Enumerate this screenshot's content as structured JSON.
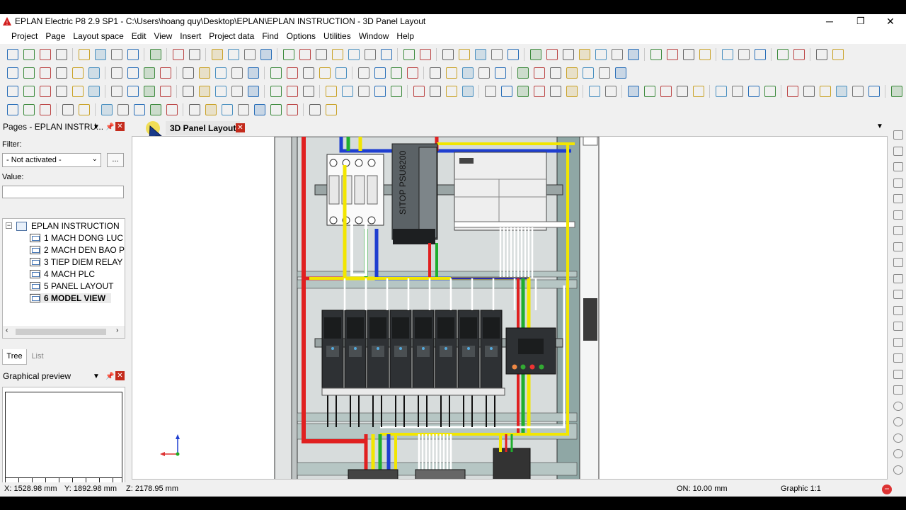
{
  "window": {
    "title": "EPLAN Electric P8 2.9 SP1 - C:\\Users\\hoang quy\\Desktop\\EPLAN\\EPLAN INSTRUCTION - 3D Panel Layout",
    "minimize": "─",
    "restore": "❐",
    "close": "✕"
  },
  "menu": [
    "Project",
    "Page",
    "Layout space",
    "Edit",
    "View",
    "Insert",
    "Project data",
    "Find",
    "Options",
    "Utilities",
    "Window",
    "Help"
  ],
  "pages_panel": {
    "title": "Pages - EPLAN INSTRU...",
    "filter_label": "Filter:",
    "filter_value": "- Not activated -",
    "filter_more": "...",
    "value_label": "Value:",
    "value_text": "",
    "tree_root": "EPLAN INSTRUCTION",
    "pages": [
      {
        "label": "1 MACH DONG LUC",
        "bold": false
      },
      {
        "label": "2 MACH DEN BAO PHA",
        "bold": false
      },
      {
        "label": "3 TIEP DIEM RELAY",
        "bold": false
      },
      {
        "label": "4 MACH PLC",
        "bold": false
      },
      {
        "label": "5 PANEL LAYOUT",
        "bold": false
      },
      {
        "label": "6 MODEL VIEW",
        "bold": true
      }
    ],
    "tab_tree": "Tree",
    "tab_list": "List"
  },
  "preview_panel": {
    "title": "Graphical preview"
  },
  "editor": {
    "tab_label": "3D Panel Layout",
    "psu_label": "SITOP PSU8200",
    "colors": {
      "red": "#e02020",
      "blue": "#1f3fd0",
      "green": "#1fae2e",
      "yellow": "#f2e600",
      "gray": "#d7dcdc",
      "module": "#2e3134"
    }
  },
  "status": {
    "x": "X: 1528.98 mm",
    "y": "Y: 1892.98 mm",
    "z": "Z: 2178.95 mm",
    "on": "ON: 10.00 mm",
    "graphic": "Graphic 1:1"
  }
}
